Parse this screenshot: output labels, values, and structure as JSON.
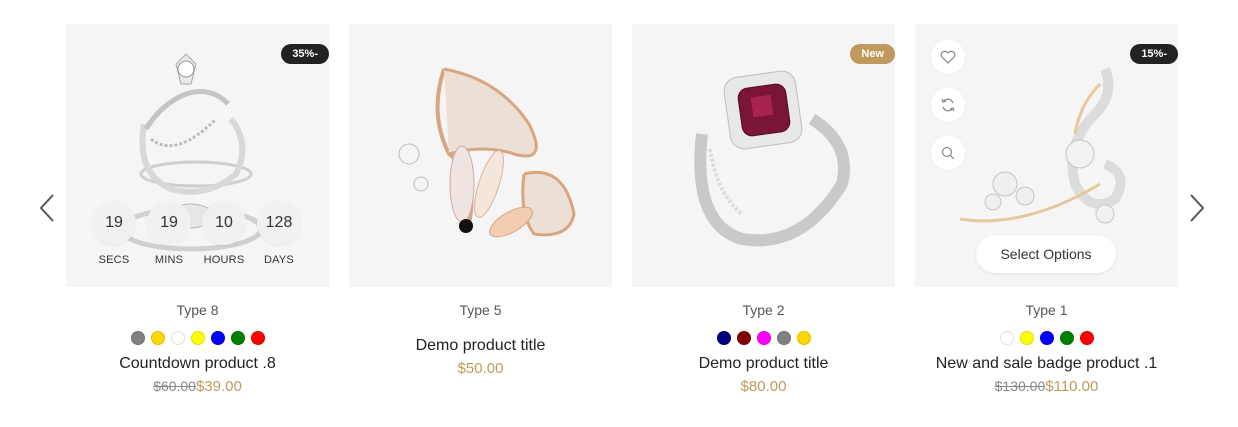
{
  "carousel": {
    "prev_icon": "chevron-left-icon",
    "next_icon": "chevron-right-icon"
  },
  "products": [
    {
      "badge": "35%-",
      "type": "Type 8",
      "title": "Countdown product .8",
      "old_price": "$60.00",
      "price": "$39.00",
      "swatches": [
        "#808080",
        "#ffd700",
        "#ffffff",
        "#ffff00",
        "#0000ff",
        "#008000",
        "#ff0000"
      ],
      "countdown": [
        {
          "value": "19",
          "label": "SECS"
        },
        {
          "value": "19",
          "label": "MINS"
        },
        {
          "value": "10",
          "label": "HOURS"
        },
        {
          "value": "128",
          "label": "DAYS"
        }
      ]
    },
    {
      "type": "Type 5",
      "title": "Demo product title",
      "price": "$50.00"
    },
    {
      "badge": "New",
      "type": "Type 2",
      "title": "Demo product title",
      "price": "$80.00",
      "swatches": [
        "#000080",
        "#800000",
        "#ff00ff",
        "#808080",
        "#ffd700"
      ]
    },
    {
      "badge": "15%-",
      "type": "Type 1",
      "title": "New and sale badge product .1",
      "old_price": "$130.00",
      "price": "$110.00",
      "select_label": "Select Options",
      "swatches": [
        "#ffffff",
        "#ffff00",
        "#0000ff",
        "#008000",
        "#ff0000"
      ],
      "actions": [
        "heart-icon",
        "refresh-icon",
        "search-icon"
      ]
    }
  ],
  "colors": {
    "accent": "#c09a5c",
    "badge_dark": "#222222",
    "card_bg": "#f5f5f5"
  }
}
